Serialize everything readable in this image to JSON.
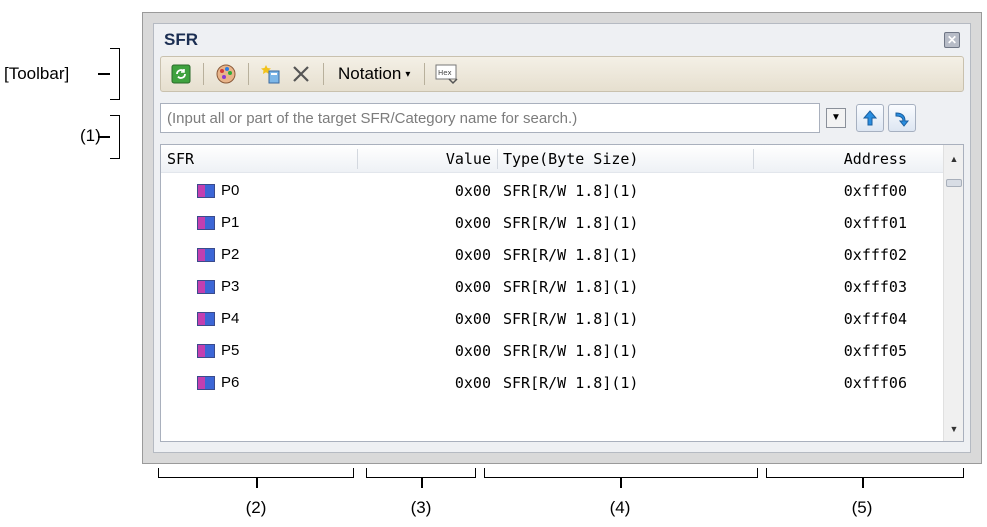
{
  "callouts": {
    "toolbar": "[Toolbar]",
    "search": "(1)",
    "col_sfr": "(2)",
    "col_value": "(3)",
    "col_type": "(4)",
    "col_address": "(5)"
  },
  "window": {
    "title": "SFR",
    "close_icon": "close-icon"
  },
  "toolbar": {
    "refresh_icon": "refresh-icon",
    "color_icon": "color-palette-icon",
    "new_category_icon": "new-category-icon",
    "delete_icon": "delete-icon",
    "notation_label": "Notation",
    "hex_label": "Hex"
  },
  "search": {
    "placeholder": "(Input all or part of the target SFR/Category name for search.)"
  },
  "table": {
    "headers": {
      "sfr": "SFR",
      "value": "Value",
      "type": "Type(Byte Size)",
      "address": "Address"
    },
    "rows": [
      {
        "name": "P0",
        "value": "0x00",
        "type": "SFR[R/W 1.8](1)",
        "address": "0xfff00"
      },
      {
        "name": "P1",
        "value": "0x00",
        "type": "SFR[R/W 1.8](1)",
        "address": "0xfff01"
      },
      {
        "name": "P2",
        "value": "0x00",
        "type": "SFR[R/W 1.8](1)",
        "address": "0xfff02"
      },
      {
        "name": "P3",
        "value": "0x00",
        "type": "SFR[R/W 1.8](1)",
        "address": "0xfff03"
      },
      {
        "name": "P4",
        "value": "0x00",
        "type": "SFR[R/W 1.8](1)",
        "address": "0xfff04"
      },
      {
        "name": "P5",
        "value": "0x00",
        "type": "SFR[R/W 1.8](1)",
        "address": "0xfff05"
      },
      {
        "name": "P6",
        "value": "0x00",
        "type": "SFR[R/W 1.8](1)",
        "address": "0xfff06"
      }
    ]
  }
}
